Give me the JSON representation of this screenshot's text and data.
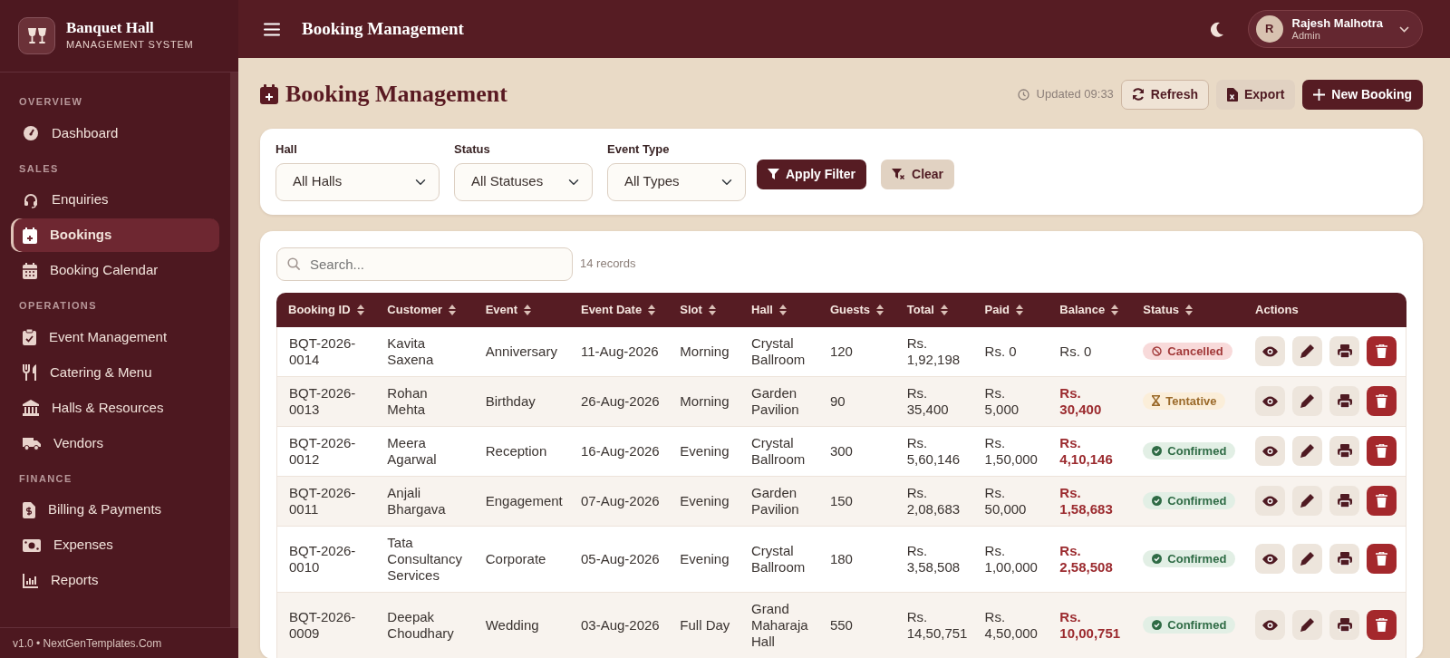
{
  "brand": {
    "title": "Banquet Hall",
    "subtitle": "MANAGEMENT SYSTEM"
  },
  "sidebar": {
    "sections": [
      {
        "label": "OVERVIEW",
        "items": [
          {
            "label": "Dashboard",
            "selected": false
          }
        ]
      },
      {
        "label": "SALES",
        "items": [
          {
            "label": "Enquiries",
            "selected": false
          },
          {
            "label": "Bookings",
            "selected": true
          },
          {
            "label": "Booking Calendar",
            "selected": false
          }
        ]
      },
      {
        "label": "OPERATIONS",
        "items": [
          {
            "label": "Event Management",
            "selected": false
          },
          {
            "label": "Catering & Menu",
            "selected": false
          },
          {
            "label": "Halls & Resources",
            "selected": false
          },
          {
            "label": "Vendors",
            "selected": false
          }
        ]
      },
      {
        "label": "FINANCE",
        "items": [
          {
            "label": "Billing & Payments",
            "selected": false
          },
          {
            "label": "Expenses",
            "selected": false
          },
          {
            "label": "Reports",
            "selected": false
          }
        ]
      }
    ],
    "footer": "v1.0 • NextGenTemplates.Com"
  },
  "topbar": {
    "title": "Booking Management",
    "user": {
      "initial": "R",
      "name": "Rajesh Malhotra",
      "role": "Admin"
    }
  },
  "page": {
    "title": "Booking Management",
    "updated": "Updated 09:33",
    "buttons": [
      {
        "label": "Refresh",
        "kind": "outline"
      },
      {
        "label": "Export",
        "kind": "soft"
      },
      {
        "label": "New Booking",
        "kind": "primary"
      }
    ]
  },
  "filters": {
    "fields": [
      {
        "label": "Hall",
        "value": "All Halls"
      },
      {
        "label": "Status",
        "value": "All Statuses"
      },
      {
        "label": "Event Type",
        "value": "All Types"
      }
    ],
    "buttons": [
      {
        "label": "Apply Filter",
        "kind": "primary"
      },
      {
        "label": "Clear",
        "kind": "soft"
      }
    ]
  },
  "table": {
    "search": {
      "placeholder": "Search..."
    },
    "count": "14 records",
    "columns": [
      {
        "label": "Booking ID",
        "sortable": true
      },
      {
        "label": "Customer",
        "sortable": true
      },
      {
        "label": "Event",
        "sortable": true
      },
      {
        "label": "Event Date",
        "sortable": true
      },
      {
        "label": "Slot",
        "sortable": true
      },
      {
        "label": "Hall",
        "sortable": true
      },
      {
        "label": "Guests",
        "sortable": true
      },
      {
        "label": "Total",
        "sortable": true
      },
      {
        "label": "Paid",
        "sortable": true
      },
      {
        "label": "Balance",
        "sortable": true
      },
      {
        "label": "Status",
        "sortable": true
      },
      {
        "label": "Actions",
        "sortable": false
      }
    ],
    "rows": [
      {
        "id": "BQT-2026-0014",
        "customer": "Kavita Saxena",
        "event": "Anniversary",
        "date": "11-Aug-2026",
        "slot": "Morning",
        "hall": "Crystal Ballroom",
        "guests": "120",
        "total": "Rs. 1,92,198",
        "paid": "Rs. 0",
        "balance": "Rs. 0",
        "balance_due": false,
        "status": {
          "label": "Cancelled",
          "kind": "cancelled"
        }
      },
      {
        "id": "BQT-2026-0013",
        "customer": "Rohan Mehta",
        "event": "Birthday",
        "date": "26-Aug-2026",
        "slot": "Morning",
        "hall": "Garden Pavilion",
        "guests": "90",
        "total": "Rs. 35,400",
        "paid": "Rs. 5,000",
        "balance": "Rs. 30,400",
        "balance_due": true,
        "status": {
          "label": "Tentative",
          "kind": "tentative"
        }
      },
      {
        "id": "BQT-2026-0012",
        "customer": "Meera Agarwal",
        "event": "Reception",
        "date": "16-Aug-2026",
        "slot": "Evening",
        "hall": "Crystal Ballroom",
        "guests": "300",
        "total": "Rs. 5,60,146",
        "paid": "Rs. 1,50,000",
        "balance": "Rs. 4,10,146",
        "balance_due": true,
        "status": {
          "label": "Confirmed",
          "kind": "confirmed"
        }
      },
      {
        "id": "BQT-2026-0011",
        "customer": "Anjali Bhargava",
        "event": "Engagement",
        "date": "07-Aug-2026",
        "slot": "Evening",
        "hall": "Garden Pavilion",
        "guests": "150",
        "total": "Rs. 2,08,683",
        "paid": "Rs. 50,000",
        "balance": "Rs. 1,58,683",
        "balance_due": true,
        "status": {
          "label": "Confirmed",
          "kind": "confirmed"
        }
      },
      {
        "id": "BQT-2026-0010",
        "customer": "Tata Consultancy Services",
        "event": "Corporate",
        "date": "05-Aug-2026",
        "slot": "Evening",
        "hall": "Crystal Ballroom",
        "guests": "180",
        "total": "Rs. 3,58,508",
        "paid": "Rs. 1,00,000",
        "balance": "Rs. 2,58,508",
        "balance_due": true,
        "status": {
          "label": "Confirmed",
          "kind": "confirmed"
        }
      },
      {
        "id": "BQT-2026-0009",
        "customer": "Deepak Choudhary",
        "event": "Wedding",
        "date": "03-Aug-2026",
        "slot": "Full Day",
        "hall": "Grand Maharaja Hall",
        "guests": "550",
        "total": "Rs. 14,50,751",
        "paid": "Rs. 4,50,000",
        "balance": "Rs. 10,00,751",
        "balance_due": true,
        "status": {
          "label": "Confirmed",
          "kind": "confirmed"
        }
      }
    ]
  }
}
